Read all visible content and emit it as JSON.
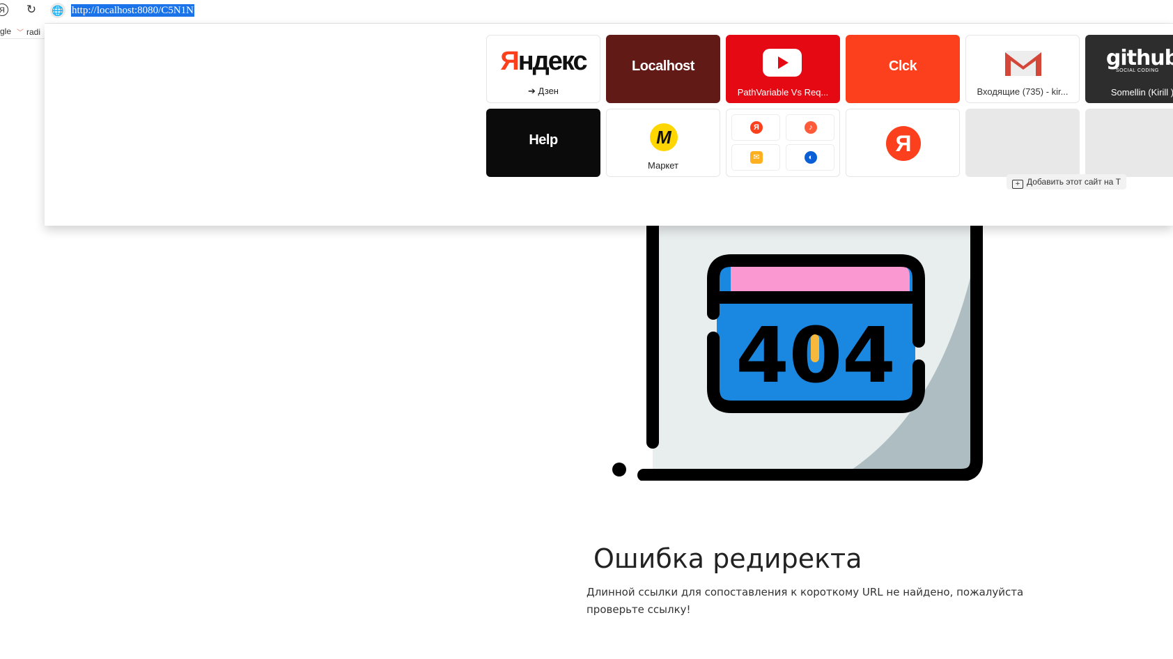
{
  "browser": {
    "yandex_button": "Я",
    "reload_icon": "reload-icon",
    "bookmarks": [
      {
        "label": "gle"
      },
      {
        "label": "radi"
      }
    ],
    "address": {
      "url": "http://localhost:8080/C5N1N"
    }
  },
  "tiles_row1": [
    {
      "name": "Яндекс",
      "caption": "➔ Дзен",
      "bg": "#ffffff"
    },
    {
      "name": "Localhost",
      "caption": "",
      "bg": "#611a15"
    },
    {
      "name": "YouTube",
      "caption": "PathVariable Vs Req...",
      "bg": "#e50914"
    },
    {
      "name": "Clck",
      "caption": "",
      "bg": "#fc3f1d"
    },
    {
      "name": "Gmail",
      "caption": "Входящие (735) - kir...",
      "bg": "#ffffff"
    },
    {
      "name": "github",
      "caption": "Somellin (Kirill )",
      "bg": "#2d2d2d"
    }
  ],
  "tiles_row2": [
    {
      "name": "Help",
      "caption": "",
      "bg": "#0b0b0b"
    },
    {
      "name": "Маркет",
      "caption": "Маркет",
      "bg": "#ffffff"
    },
    {
      "name": "yandex-services",
      "caption": "",
      "bg": "#ffffff"
    },
    {
      "name": "yandex-circle",
      "caption": "",
      "bg": "#ffffff"
    },
    {
      "name": "empty-1",
      "caption": "",
      "bg": "#e8e8e8"
    },
    {
      "name": "empty-2",
      "caption": "",
      "bg": "#e8e8e8"
    }
  ],
  "tile_text": {
    "yandex_first": "Я",
    "yandex_rest": "ндекс",
    "github_word": "github",
    "github_sub": "SOCIAL CODING",
    "market_letter": "M",
    "ya_letter": "Я"
  },
  "add_site": "Добавить этот сайт на Т",
  "error": {
    "illustration_text": "404",
    "title": "Ошибка редиректа",
    "message": "Длинной ссылки для сопоставления к короткому URL не найдено, пожалуйста проверьте ссылку!"
  },
  "colors": {
    "accent_blue": "#1a73e8",
    "yandex_red": "#fc3f1d",
    "illustration_blue": "#1a88e0",
    "illustration_pink": "#f998d1"
  }
}
